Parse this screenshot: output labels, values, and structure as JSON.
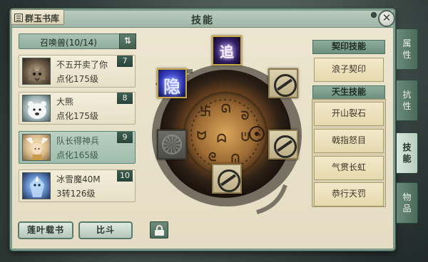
{
  "header": {
    "library_label": "群玉书库",
    "title": "技能"
  },
  "summon_list": {
    "title": "召唤兽(10/14)",
    "sort_icon": "sort-icon",
    "pets": [
      {
        "name": "不五开卖了你",
        "level": "点化175级",
        "index": "7"
      },
      {
        "name": "大熊",
        "level": "点化175级",
        "index": "8"
      },
      {
        "name": "队长得神兵",
        "level": "点化165级",
        "index": "9"
      },
      {
        "name": "冰雪魔40M",
        "level": "3转126级",
        "index": "10"
      }
    ]
  },
  "bottom_buttons": {
    "lotus_book": "莲叶载书",
    "compare": "比斗"
  },
  "skill_wheel": {
    "slots": [
      {
        "id": "top",
        "label": "追"
      },
      {
        "id": "left-upper",
        "label": "隐"
      }
    ]
  },
  "contract_skills": {
    "title": "契印技能",
    "items": [
      "浪子契印"
    ]
  },
  "innate_skills": {
    "title": "天生技能",
    "items": [
      "开山裂石",
      "戟指怒目",
      "气贯长虹",
      "恭行天罚"
    ]
  },
  "side_tabs": [
    {
      "label": "属性",
      "active": false
    },
    {
      "label": "抗性",
      "active": false
    },
    {
      "label": "技能",
      "active": true
    },
    {
      "label": "物品",
      "active": false
    }
  ],
  "colors": {
    "panel_bg": "#e9e2c9",
    "accent_green": "#6d8f7d",
    "selected_row": "#a9c4b5"
  }
}
